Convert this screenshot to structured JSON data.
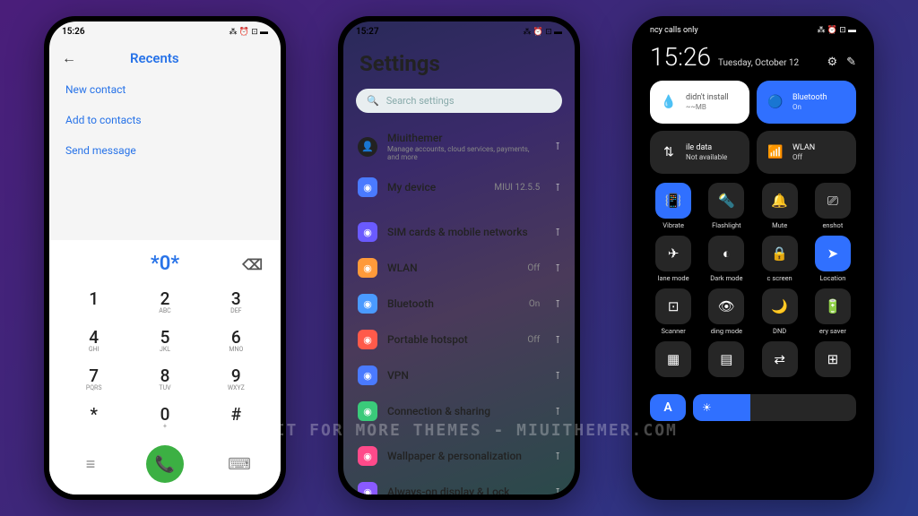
{
  "watermark": "VISIT FOR MORE THEMES - MIUITHEMER.COM",
  "phone1": {
    "status_time": "15:26",
    "title": "Recents",
    "links": [
      "New contact",
      "Add to contacts",
      "Send message"
    ],
    "dialed": "*0*",
    "keypad": [
      {
        "n": "1",
        "s": ""
      },
      {
        "n": "2",
        "s": "ABC"
      },
      {
        "n": "3",
        "s": "DEF"
      },
      {
        "n": "4",
        "s": "GHI"
      },
      {
        "n": "5",
        "s": "JKL"
      },
      {
        "n": "6",
        "s": "MNO"
      },
      {
        "n": "7",
        "s": "PQRS"
      },
      {
        "n": "8",
        "s": "TUV"
      },
      {
        "n": "9",
        "s": "WXYZ"
      },
      {
        "n": "*",
        "s": ""
      },
      {
        "n": "0",
        "s": "+"
      },
      {
        "n": "#",
        "s": ""
      }
    ]
  },
  "phone2": {
    "status_time": "15:27",
    "title": "Settings",
    "search": "Search settings",
    "account": {
      "name": "Miuithemer",
      "sub": "Manage accounts, cloud services, payments, and more"
    },
    "items": [
      {
        "icon_bg": "#4a7aff",
        "title": "My device",
        "val": "MIUI 12.5.5"
      },
      {
        "icon_bg": "#6a5aff",
        "title": "SIM cards & mobile networks",
        "val": ""
      },
      {
        "icon_bg": "#ff9a3a",
        "title": "WLAN",
        "val": "Off"
      },
      {
        "icon_bg": "#4a9aff",
        "title": "Bluetooth",
        "val": "On"
      },
      {
        "icon_bg": "#ff5a4a",
        "title": "Portable hotspot",
        "val": "Off"
      },
      {
        "icon_bg": "#4a7aff",
        "title": "VPN",
        "val": ""
      },
      {
        "icon_bg": "#3aca7a",
        "title": "Connection & sharing",
        "val": ""
      },
      {
        "icon_bg": "#ff4a8a",
        "title": "Wallpaper & personalization",
        "val": ""
      },
      {
        "icon_bg": "#8a5aff",
        "title": "Always-on display & Lock",
        "val": ""
      }
    ]
  },
  "phone3": {
    "top_status": "ncy calls only",
    "time": "15:26",
    "date": "Tuesday, October 12",
    "tiles": [
      {
        "cls": "tile-white",
        "title": "didn't install",
        "sub": "~~MB"
      },
      {
        "cls": "tile-blue",
        "title": "Bluetooth",
        "sub": "On"
      },
      {
        "cls": "tile-glass",
        "title": "ile data",
        "sub": "Not available"
      },
      {
        "cls": "tile-glass",
        "title": "WLAN",
        "sub": "Off"
      }
    ],
    "quick": [
      {
        "on": true,
        "icon": "📳",
        "label": "Vibrate"
      },
      {
        "on": false,
        "icon": "🔦",
        "label": "Flashlight"
      },
      {
        "on": false,
        "icon": "🔔",
        "label": "Mute"
      },
      {
        "on": false,
        "icon": "⎚",
        "label": "enshot"
      },
      {
        "on": false,
        "icon": "✈",
        "label": "lane mode"
      },
      {
        "on": false,
        "icon": "◐",
        "label": "Dark mode"
      },
      {
        "on": false,
        "icon": "🔒",
        "label": "c screen"
      },
      {
        "on": true,
        "icon": "➤",
        "label": "Location"
      },
      {
        "on": false,
        "icon": "⊡",
        "label": "Scanner"
      },
      {
        "on": false,
        "icon": "👁",
        "label": "ding mode"
      },
      {
        "on": false,
        "icon": "🌙",
        "label": "DND"
      },
      {
        "on": false,
        "icon": "🔋",
        "label": "ery saver"
      },
      {
        "on": false,
        "icon": "▦",
        "label": ""
      },
      {
        "on": false,
        "icon": "▤",
        "label": ""
      },
      {
        "on": false,
        "icon": "⇄",
        "label": ""
      },
      {
        "on": false,
        "icon": "⊞",
        "label": ""
      }
    ],
    "auto": "A"
  }
}
